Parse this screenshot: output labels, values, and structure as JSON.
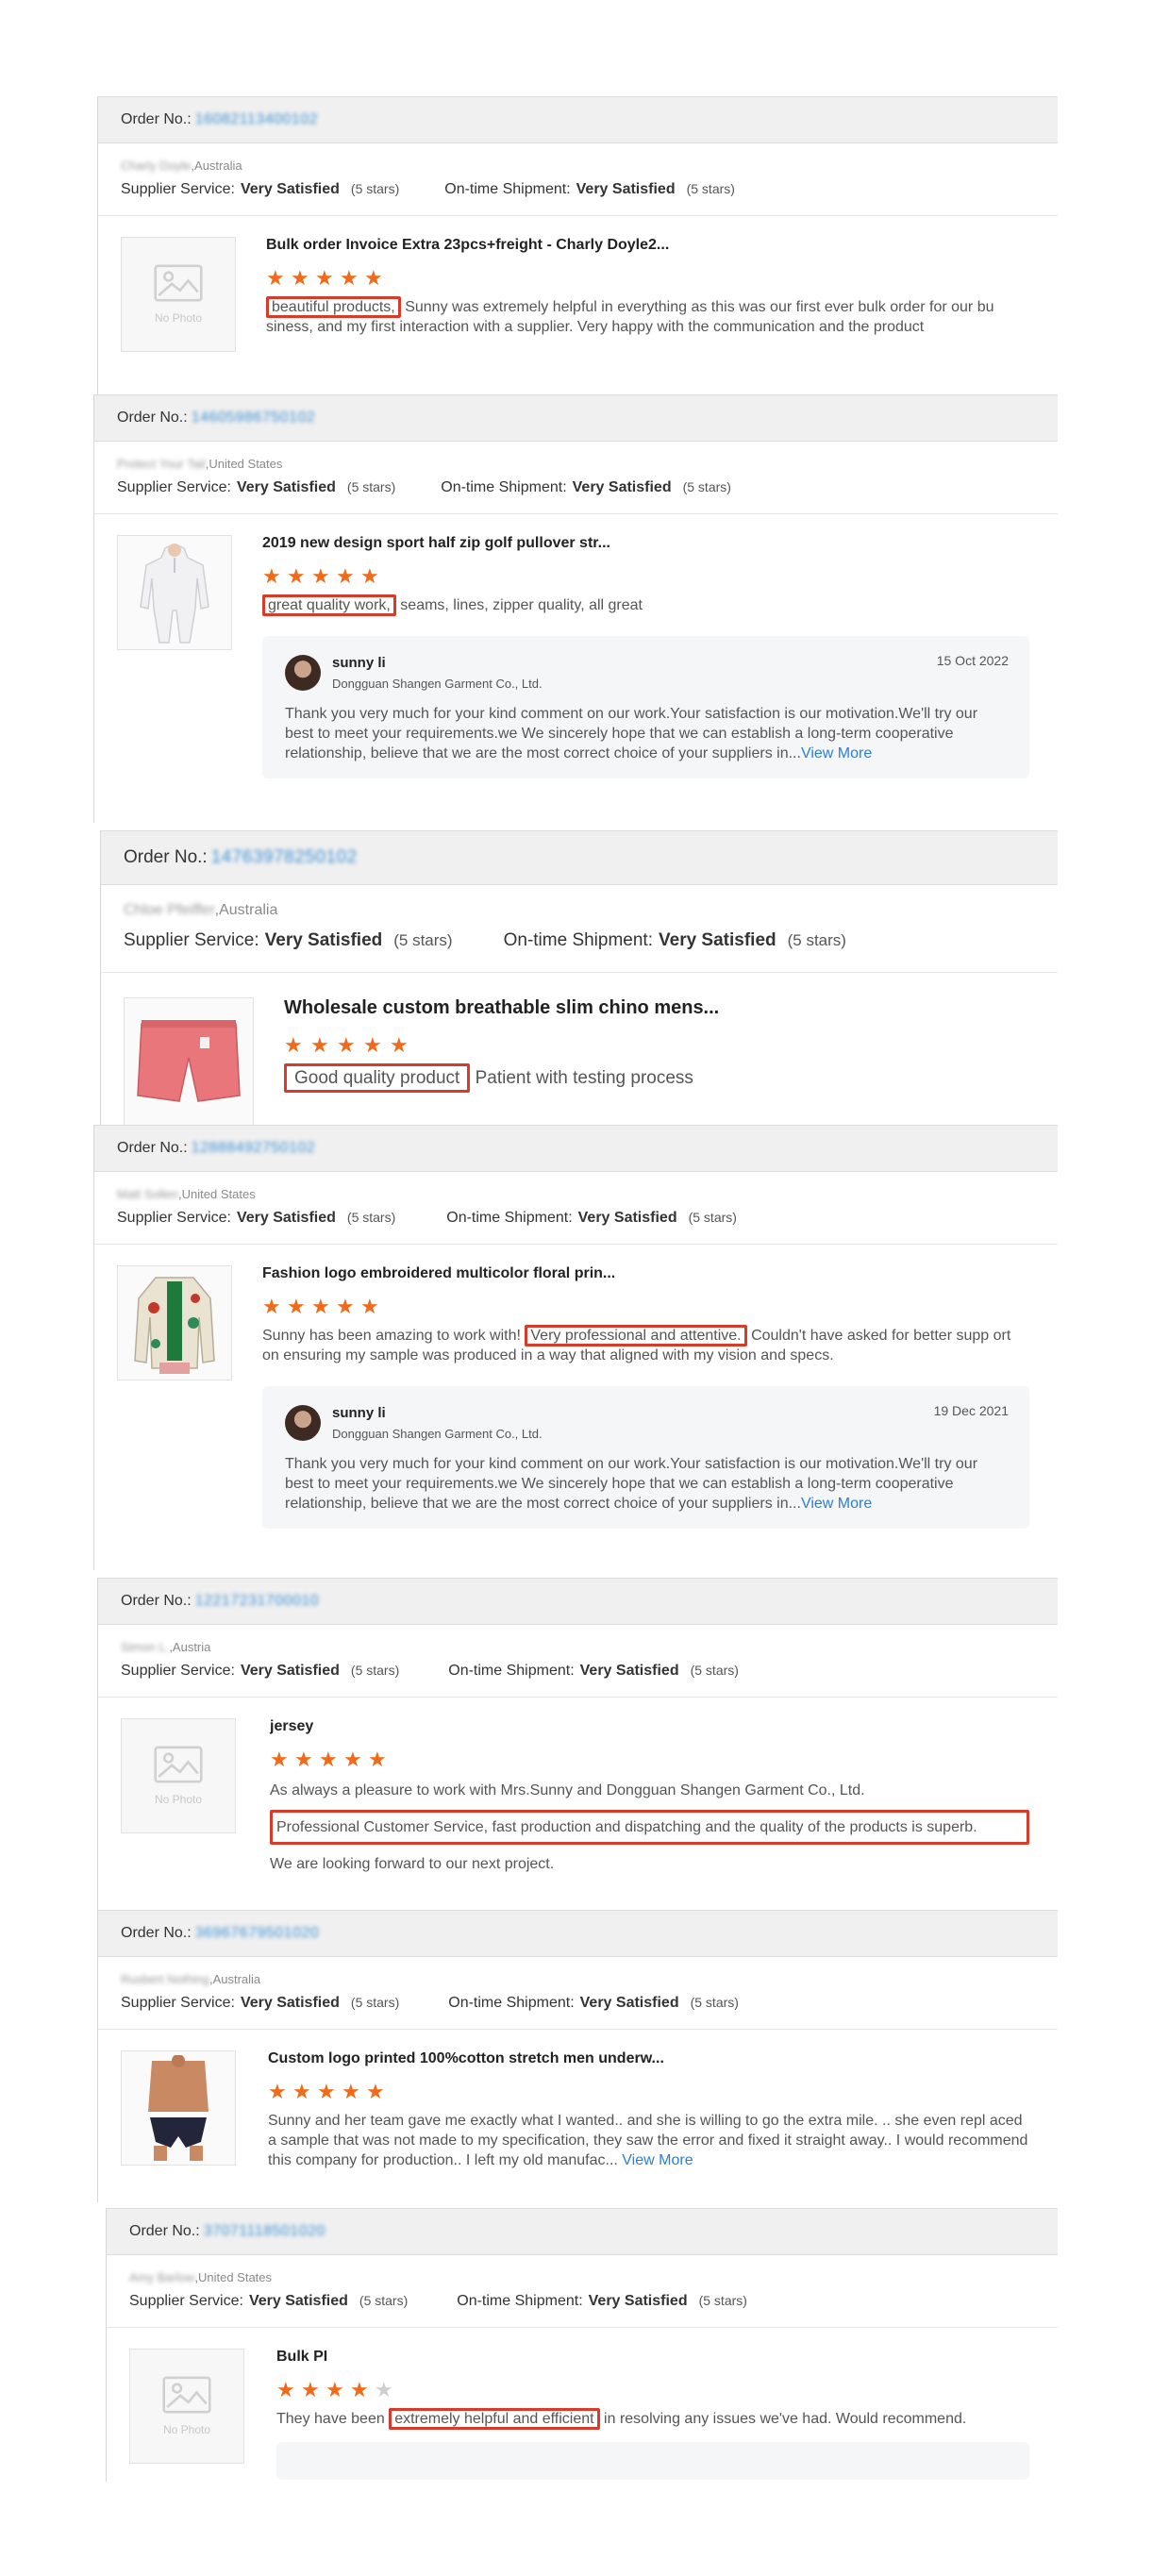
{
  "labels": {
    "order_prefix": "Order No.:",
    "supplier_service": "Supplier Service:",
    "on_time": "On-time Shipment:",
    "no_photo": "No Photo",
    "view_more": "View More"
  },
  "colors": {
    "accent": "#f06a1a",
    "highlight_box": "#d93b2b",
    "link": "#2a7fd4"
  },
  "reviews": [
    {
      "order_no": "16082113400102",
      "buyer_name": "Charly Doyle",
      "buyer_country": ",Australia",
      "supplier_rating": "Very Satisfied",
      "supplier_stars": "(5 stars)",
      "shipment_rating": "Very Satisfied",
      "shipment_stars": "(5 stars)",
      "product_title": "Bulk order Invoice Extra 23pcs+freight - Charly Doyle2...",
      "stars": 5,
      "highlight": "beautiful products,",
      "text": " Sunny was extremely helpful in everything as this was our first ever bulk order for our bu siness, and my first interaction with a supplier. Very happy with the communication and the product"
    },
    {
      "order_no": "14605986750102",
      "buyer_name": "Protect Your Tail",
      "buyer_country": ",United States",
      "supplier_rating": "Very Satisfied",
      "supplier_stars": "(5 stars)",
      "shipment_rating": "Very Satisfied",
      "shipment_stars": "(5 stars)",
      "product_title": "2019 new design sport half zip golf pullover str...",
      "stars": 5,
      "highlight": "great quality work,",
      "text": " seams, lines, zipper quality, all great",
      "reply": {
        "name": "sunny li",
        "company": "Dongguan Shangen Garment Co., Ltd.",
        "date": "15 Oct 2022",
        "text": "Thank you very much for your kind comment on our work.Your satisfaction is our motivation.We'll try our best to meet your requirements.we We sincerely hope that we can establish a long-term cooperative relationship, believe that we are the most correct choice of your suppliers in...",
        "more": "View More"
      }
    },
    {
      "order_no": "14763978250102",
      "buyer_name": "Chloe Pfeiffer",
      "buyer_country": ",Australia",
      "supplier_rating": "Very Satisfied",
      "supplier_stars": "(5 stars)",
      "shipment_rating": "Very Satisfied",
      "shipment_stars": "(5 stars)",
      "product_title": "Wholesale custom breathable slim chino mens...",
      "stars": 5,
      "highlight": "Good quality product",
      "text": " Patient with testing process"
    },
    {
      "order_no": "12888492750102",
      "buyer_name": "Matt Sollen",
      "buyer_country": ",United States",
      "supplier_rating": "Very Satisfied",
      "supplier_stars": "(5 stars)",
      "shipment_rating": "Very Satisfied",
      "shipment_stars": "(5 stars)",
      "product_title": "Fashion logo embroidered multicolor floral prin...",
      "stars": 5,
      "pre": "Sunny has been amazing to work with! ",
      "highlight": "Very professional and attentive.",
      "text": " Couldn't have asked for better supp ort on ensuring my sample was produced in a way that aligned with my vision and specs.",
      "reply": {
        "name": "sunny li",
        "company": "Dongguan Shangen Garment Co., Ltd.",
        "date": "19 Dec 2021",
        "text": "Thank you very much for your kind comment on our work.Your satisfaction is our motivation.We'll try our best to meet your requirements.we We sincerely hope that we can establish a long-term cooperative relationship, believe that we are the most correct choice of your suppliers in...",
        "more": "View More"
      }
    },
    {
      "order_no": "12217231700010",
      "buyer_name": "Simon L.",
      "buyer_country": ",Austria",
      "supplier_rating": "Very Satisfied",
      "supplier_stars": "(5 stars)",
      "shipment_rating": "Very Satisfied",
      "shipment_stars": "(5 stars)",
      "product_title": "jersey",
      "stars": 5,
      "line1": "As always a pleasure to work with Mrs.Sunny and Dongguan Shangen Garment Co., Ltd.",
      "highlight": "Professional Customer Service, fast production and dispatching and the quality of the products is superb.",
      "line3": "We are looking forward to our next project."
    },
    {
      "order_no": "36967679501020",
      "buyer_name": "Rusbert Nothing",
      "buyer_country": ",Australia",
      "supplier_rating": "Very Satisfied",
      "supplier_stars": "(5 stars)",
      "shipment_rating": "Very Satisfied",
      "shipment_stars": "(5 stars)",
      "product_title": "Custom logo printed 100%cotton stretch men underw...",
      "stars": 5,
      "text": "Sunny and her team gave me exactly what I wanted.. and she is willing to go the extra mile. .. she even repl aced a sample that was not made to my specification, they saw the error and fixed it straight away.. I would recommend this company for production.. I left my old manufac...",
      "more": "View More"
    },
    {
      "order_no": "37071118501020",
      "buyer_name": "Amy Barlow",
      "buyer_country": ",United States",
      "supplier_rating": "Very Satisfied",
      "supplier_stars": "(5 stars)",
      "shipment_rating": "Very Satisfied",
      "shipment_stars": "(5 stars)",
      "product_title": "Bulk PI",
      "stars": 4,
      "pre": "They have been ",
      "highlight": "extremely helpful and efficient",
      "text": " in resolving any issues we've had. Would recommend."
    }
  ]
}
